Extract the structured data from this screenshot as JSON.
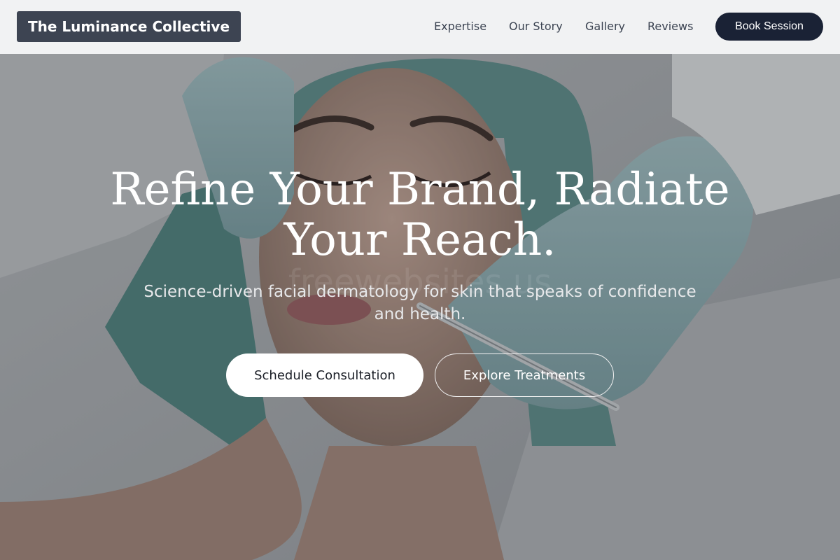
{
  "header": {
    "logo": "The Luminance Collective",
    "nav": [
      "Expertise",
      "Our Story",
      "Gallery",
      "Reviews"
    ],
    "cta": "Book Session"
  },
  "hero": {
    "headline_line1": "Refine Your Brand, Radiate",
    "headline_line2": "Your Reach.",
    "subhead_line1": "Science-driven facial dermatology for skin that speaks of confidence",
    "subhead_line2": "and health.",
    "primary_cta": "Schedule Consultation",
    "secondary_cta": "Explore Treatments",
    "watermark": "freewebsites.us"
  },
  "colors": {
    "header_bg": "#f1f2f3",
    "logo_bg": "#3d4452",
    "nav_text": "#3b4351",
    "cta_bg": "#1a2235",
    "glove": "#8fb2b6",
    "cap": "#5f8f8c"
  }
}
